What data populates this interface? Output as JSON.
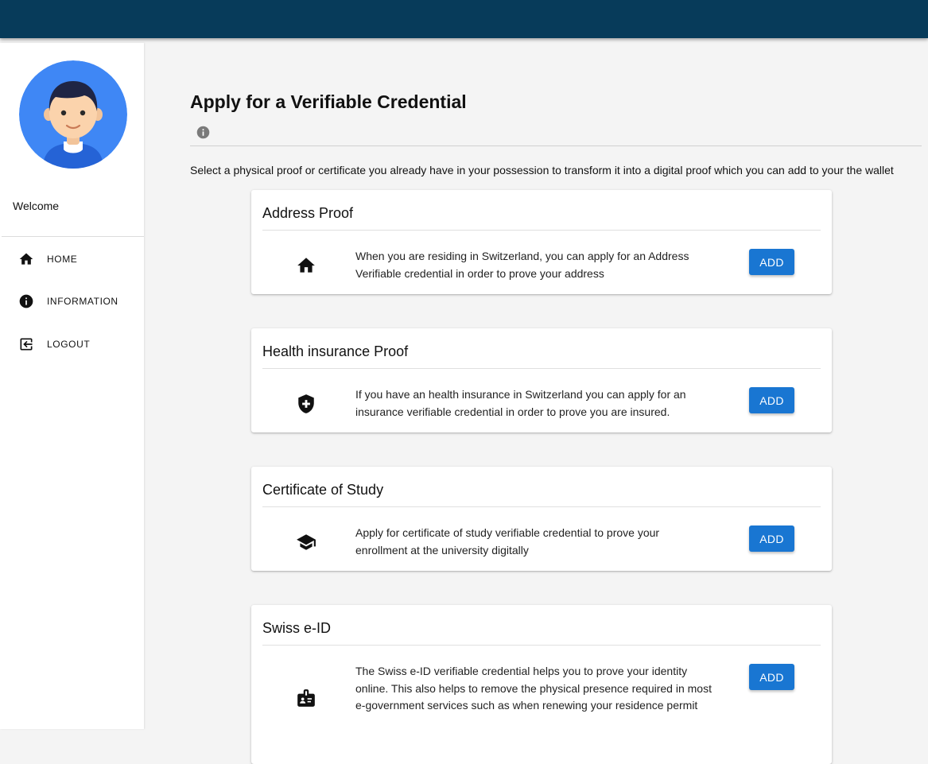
{
  "sidebar": {
    "welcome": "Welcome",
    "nav": [
      {
        "label": "HOME",
        "icon": "home-icon"
      },
      {
        "label": "INFORMATION",
        "icon": "info-icon"
      },
      {
        "label": "LOGOUT",
        "icon": "logout-icon"
      }
    ]
  },
  "main": {
    "title": "Apply for a Verifiable Credential",
    "intro": "Select a physical proof or certificate you already have in your possession to transform it into a digital proof which you can add to your the wallet",
    "cards": [
      {
        "title": "Address Proof",
        "icon": "home-icon",
        "description": "When you are residing in Switzerland, you can apply for an Address Verifiable credential in order to prove your address",
        "button": "ADD"
      },
      {
        "title": "Health insurance Proof",
        "icon": "health-shield-icon",
        "description": "If you have an health insurance in Switzerland you can apply for an insurance verifiable credential in order to prove you are insured.",
        "button": "ADD"
      },
      {
        "title": "Certificate of Study",
        "icon": "graduation-cap-icon",
        "description": "Apply for certificate of study verifiable credential to prove your enrollment at the university digitally",
        "button": "ADD"
      },
      {
        "title": "Swiss e-ID",
        "icon": "id-badge-icon",
        "description": "The Swiss e-ID verifiable credential helps you to prove your identity online. This also helps to remove the physical presence required in most e-government services such as when renewing your residence permit",
        "button": "ADD"
      }
    ]
  },
  "colors": {
    "topbar": "#073b5a",
    "button": "#1976d2",
    "avatar_bg": "#3f87f5",
    "background": "#f4f4f4"
  }
}
